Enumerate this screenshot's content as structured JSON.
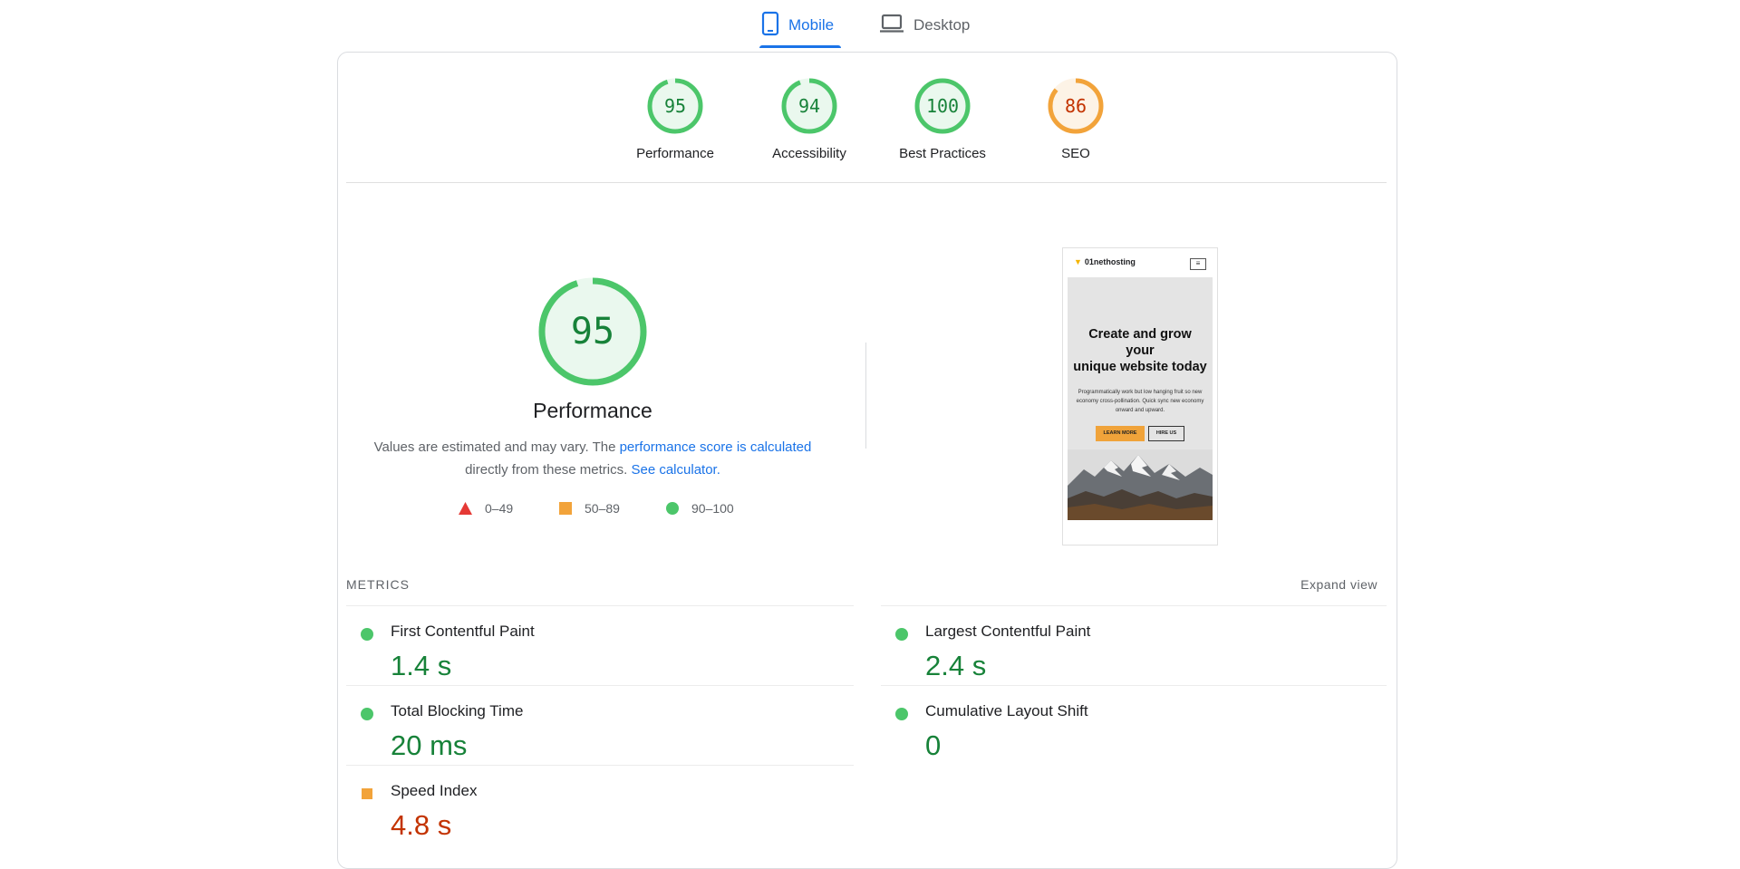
{
  "tabs": [
    {
      "label": "Mobile",
      "icon": "phone-icon",
      "active": true
    },
    {
      "label": "Desktop",
      "icon": "laptop-icon",
      "active": false
    }
  ],
  "gauges": [
    {
      "label": "Performance",
      "score": "95",
      "value": 95,
      "status": "pass"
    },
    {
      "label": "Accessibility",
      "score": "94",
      "value": 94,
      "status": "pass"
    },
    {
      "label": "Best Practices",
      "score": "100",
      "value": 100,
      "status": "pass"
    },
    {
      "label": "SEO",
      "score": "86",
      "value": 86,
      "status": "average"
    }
  ],
  "performance": {
    "score": "95",
    "value": 95,
    "title": "Performance",
    "desc_text1": "Values are estimated and may vary. The ",
    "desc_link1": "performance score is calculated",
    "desc_text2": "directly from these metrics.",
    "desc_link2": "See calculator."
  },
  "legend": [
    {
      "range": "0–49",
      "shape": "triangle",
      "color": "#e53935"
    },
    {
      "range": "50–89",
      "shape": "square",
      "color": "#f2a33a"
    },
    {
      "range": "90–100",
      "shape": "circle",
      "color": "#4cc66a"
    }
  ],
  "screenshot": {
    "brand": "01nethosting",
    "menu_icon": "menu-icon",
    "hero_title_line1": "Create and grow",
    "hero_title_line2": "your",
    "hero_title_line3": "unique website today",
    "hero_sub": "Programmatically work but low hanging fruit so new economy cross-pollination. Quick sync new economy onward and upward.",
    "btn_primary": "LEARN MORE",
    "btn_secondary": "HIRE US"
  },
  "metrics": {
    "title": "METRICS",
    "expand_label": "Expand view",
    "items": [
      {
        "name": "First Contentful Paint",
        "value": "1.4 s",
        "status": "pass"
      },
      {
        "name": "Largest Contentful Paint",
        "value": "2.4 s",
        "status": "pass"
      },
      {
        "name": "Total Blocking Time",
        "value": "20 ms",
        "status": "pass"
      },
      {
        "name": "Cumulative Layout Shift",
        "value": "0",
        "status": "pass"
      },
      {
        "name": "Speed Index",
        "value": "4.8 s",
        "status": "average"
      }
    ]
  },
  "colors": {
    "accent": "#1a73e8",
    "pass_stroke": "#4cc66a",
    "pass_fill": "#eaf8ee",
    "pass_text": "#178239",
    "average_stroke": "#f2a33a",
    "average_fill": "#fdf3e6",
    "average_text": "#c33300"
  }
}
